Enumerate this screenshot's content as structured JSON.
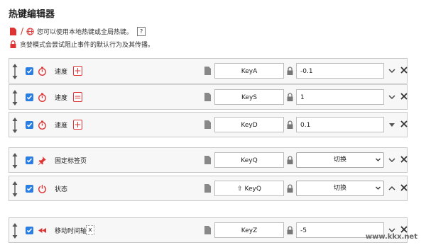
{
  "header": {
    "title": "热键编辑器"
  },
  "notes": [
    {
      "text": "您可以使用本地热键或全局热键。",
      "help": "?"
    },
    {
      "text": "贪婪模式会尝试阻止事件的默认行为及其传播。"
    }
  ],
  "rows": [
    {
      "label": "速度",
      "op": "+",
      "key": "KeyA",
      "value": "-0.1"
    },
    {
      "label": "速度",
      "op": "=",
      "key": "KeyS",
      "value": "1"
    },
    {
      "label": "速度",
      "op": "+",
      "key": "KeyD",
      "value": "0.1"
    },
    {
      "label": "固定标签页",
      "key": "KeyQ",
      "select": "切换"
    },
    {
      "label": "状态",
      "key": "⇧ KeyQ",
      "select": "切换"
    },
    {
      "label": "移动时间轴",
      "op": "x",
      "key": "KeyZ",
      "value": "-5"
    }
  ],
  "watermark": {
    "url": "www.kkx.net"
  },
  "colors": {
    "accent": "#2a7de1",
    "danger": "#d33333"
  }
}
